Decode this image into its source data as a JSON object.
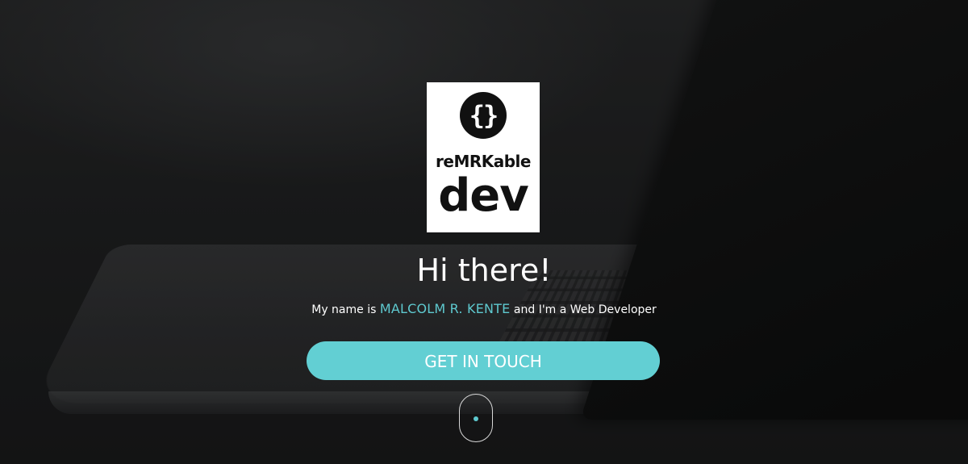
{
  "logo": {
    "icon": "curly-braces-icon",
    "icon_glyph": "{}",
    "brand_text": "reMRKable",
    "word": "dev"
  },
  "hero": {
    "headline": "Hi there!",
    "intro_prefix": "My name is ",
    "name": "MALCOLM R. KENTE",
    "intro_suffix": " and I'm a Web Developer",
    "cta_label": "GET IN TOUCH"
  },
  "scroll_indicator": {
    "icon": "mouse-scroll-icon"
  },
  "colors": {
    "accent": "#62cfd3",
    "name_highlight": "#5ec9cf",
    "text": "#ffffff",
    "background": "#222426"
  }
}
